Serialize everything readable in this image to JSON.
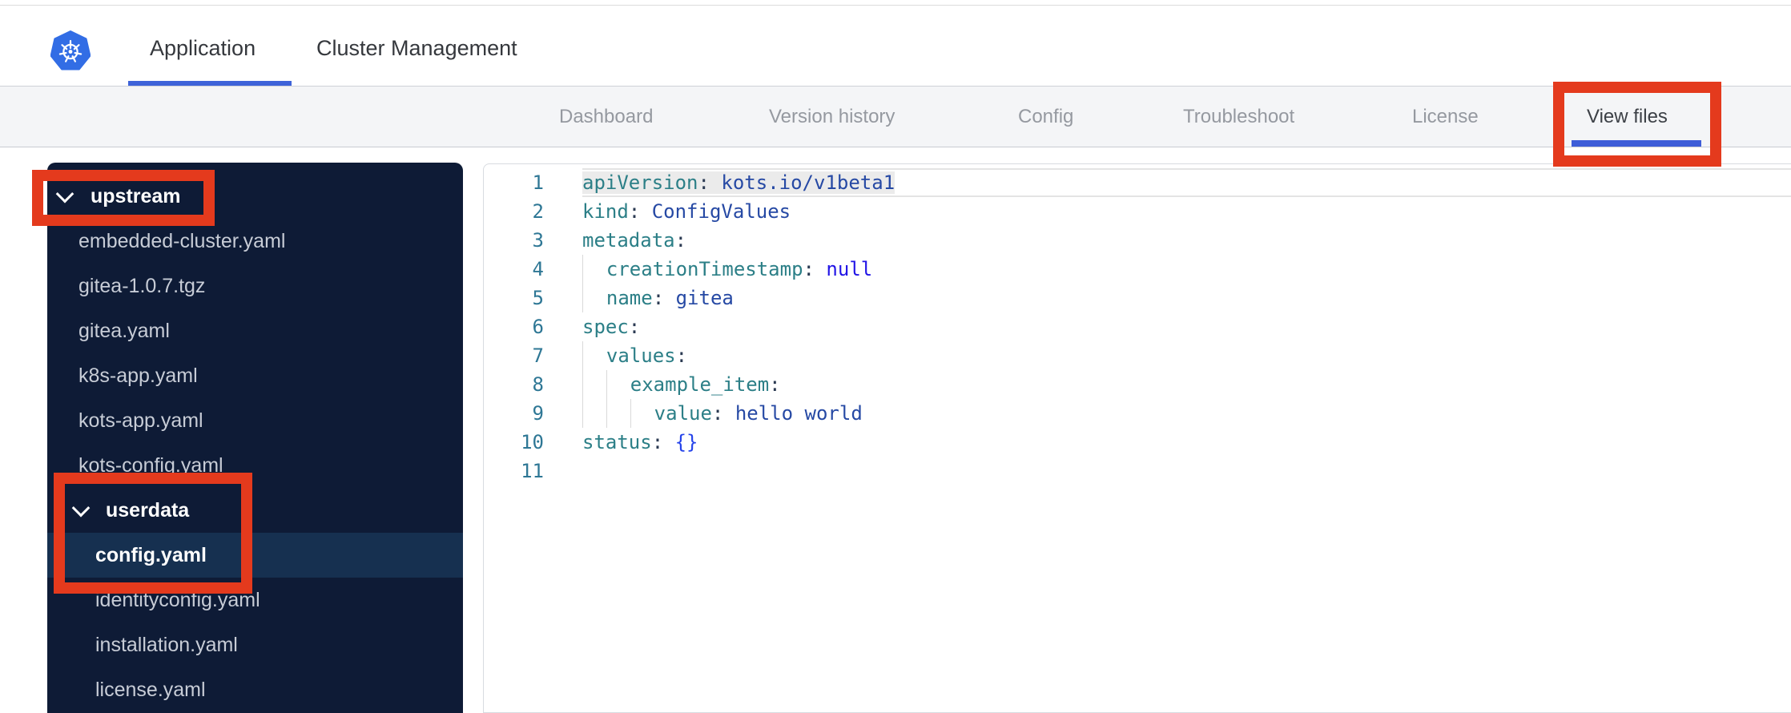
{
  "topbar": {
    "logo_icon": "kubernetes-logo",
    "tabs": [
      {
        "label": "Application",
        "active": true
      },
      {
        "label": "Cluster Management",
        "active": false
      }
    ],
    "accent_color": "#3e63d9"
  },
  "subnav": {
    "items": [
      {
        "label": "Dashboard",
        "active": false
      },
      {
        "label": "Version history",
        "active": false
      },
      {
        "label": "Config",
        "active": false
      },
      {
        "label": "Troubleshoot",
        "active": false
      },
      {
        "label": "License",
        "active": false
      },
      {
        "label": "View files",
        "active": true
      }
    ],
    "active_underline_color": "#3e5dd8"
  },
  "file_tree": {
    "background_color": "#0e1b36",
    "selected_row_color": "#163050",
    "items": [
      {
        "type": "folder",
        "label": "upstream",
        "level": 0,
        "expanded": true
      },
      {
        "type": "file",
        "label": "embedded-cluster.yaml",
        "level": 1
      },
      {
        "type": "file",
        "label": "gitea-1.0.7.tgz",
        "level": 1
      },
      {
        "type": "file",
        "label": "gitea.yaml",
        "level": 1
      },
      {
        "type": "file",
        "label": "k8s-app.yaml",
        "level": 1
      },
      {
        "type": "file",
        "label": "kots-app.yaml",
        "level": 1
      },
      {
        "type": "file",
        "label": "kots-config.yaml",
        "level": 1
      },
      {
        "type": "folder",
        "label": "userdata",
        "level": 1,
        "expanded": true
      },
      {
        "type": "file",
        "label": "config.yaml",
        "level": 2,
        "selected": true
      },
      {
        "type": "file",
        "label": "identityconfig.yaml",
        "level": 2
      },
      {
        "type": "file",
        "label": "installation.yaml",
        "level": 2
      },
      {
        "type": "file",
        "label": "license.yaml",
        "level": 2
      }
    ]
  },
  "editor": {
    "language": "yaml",
    "syntax_colors": {
      "key": "#2c7f87",
      "scalar": "#2649a4",
      "keyword": "#2114e6",
      "bracket": "#2543ea",
      "line_number": "#2e7795"
    },
    "lines": [
      {
        "num": 1,
        "indent": 0,
        "key": "apiVersion",
        "value": "kots.io/v1beta1",
        "value_type": "scalar",
        "current": true
      },
      {
        "num": 2,
        "indent": 0,
        "key": "kind",
        "value": "ConfigValues",
        "value_type": "scalar"
      },
      {
        "num": 3,
        "indent": 0,
        "key": "metadata",
        "value": null
      },
      {
        "num": 4,
        "indent": 2,
        "key": "creationTimestamp",
        "value": "null",
        "value_type": "keyword"
      },
      {
        "num": 5,
        "indent": 2,
        "key": "name",
        "value": "gitea",
        "value_type": "scalar"
      },
      {
        "num": 6,
        "indent": 0,
        "key": "spec",
        "value": null
      },
      {
        "num": 7,
        "indent": 2,
        "key": "values",
        "value": null
      },
      {
        "num": 8,
        "indent": 4,
        "key": "example_item",
        "value": null
      },
      {
        "num": 9,
        "indent": 6,
        "key": "value",
        "value": "hello world",
        "value_type": "scalar"
      },
      {
        "num": 10,
        "indent": 0,
        "key": "status",
        "value": "{}",
        "value_type": "bracket"
      },
      {
        "num": 11,
        "blank": true
      }
    ]
  },
  "annotations": {
    "color": "#e43a1d",
    "targets": [
      "upstream-folder",
      "userdata-and-config-file",
      "view-files-tab"
    ]
  }
}
